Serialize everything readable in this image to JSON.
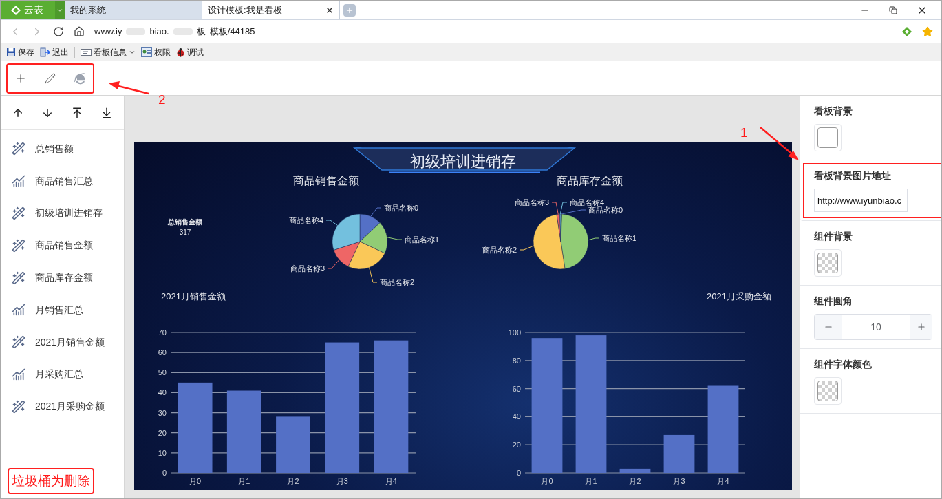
{
  "browser_tabs": [
    {
      "label": "云表",
      "kind": "app",
      "selected": false
    },
    {
      "label": "我的系统",
      "kind": "page",
      "selected": false
    },
    {
      "label": "设计模板:我是看板",
      "kind": "page",
      "selected": true
    }
  ],
  "address": {
    "parts": [
      "www.iy",
      "biao.",
      "板",
      "模板/44185"
    ]
  },
  "toolbar": [
    {
      "label": "保存",
      "kind": "save"
    },
    {
      "label": "退出",
      "kind": "exit"
    },
    {
      "label": "看板信息",
      "kind": "info"
    },
    {
      "label": "权限",
      "kind": "permission"
    },
    {
      "label": "调试",
      "kind": "debug"
    }
  ],
  "sidebar": {
    "items": [
      {
        "label": "总销售额",
        "kind": "metric"
      },
      {
        "label": "商品销售汇总",
        "kind": "chart"
      },
      {
        "label": "初级培训进销存",
        "kind": "metric"
      },
      {
        "label": "商品销售金额",
        "kind": "metric"
      },
      {
        "label": "商品库存金额",
        "kind": "metric"
      },
      {
        "label": "月销售汇总",
        "kind": "chart"
      },
      {
        "label": "2021月销售金额",
        "kind": "metric"
      },
      {
        "label": "月采购汇总",
        "kind": "chart"
      },
      {
        "label": "2021月采购金额",
        "kind": "metric"
      }
    ]
  },
  "dashboard": {
    "title": "初级培训进销存",
    "kpi": {
      "label": "总销售金额",
      "value": "317"
    },
    "pies": [
      {
        "title": "商品销售金额",
        "labels": [
          "商品名称0",
          "商品名称1",
          "商品名称2",
          "商品名称3",
          "商品名称4"
        ]
      },
      {
        "title": "商品库存金额",
        "labels": [
          "商品名称0",
          "商品名称1",
          "商品名称2",
          "商品名称3",
          "商品名称4"
        ]
      }
    ],
    "bar_charts": [
      {
        "chart_data": {
          "type": "bar",
          "title": "2021月销售金额",
          "categories": [
            "月0",
            "月1",
            "月2",
            "月3",
            "月4"
          ],
          "series": [
            {
              "color": "#5470c6",
              "values": [
                45,
                41,
                28,
                65,
                66
              ]
            }
          ],
          "grid": true,
          "ylim": [
            0,
            70
          ],
          "yticks": [
            0,
            10,
            20,
            30,
            40,
            50,
            60,
            70
          ]
        }
      },
      {
        "chart_data": {
          "type": "bar",
          "title": "2021月采购金额",
          "categories": [
            "月0",
            "月1",
            "月2",
            "月3",
            "月4"
          ],
          "series": [
            {
              "color": "#5470c6",
              "values": [
                96,
                98,
                3,
                27,
                62
              ]
            }
          ],
          "grid": true,
          "ylim": [
            0,
            100
          ],
          "yticks": [
            0,
            20,
            40,
            60,
            80,
            100
          ]
        }
      }
    ]
  },
  "properties": [
    {
      "label": "看板背景",
      "kind": "swatch",
      "transparent": false
    },
    {
      "label": "看板背景图片地址",
      "kind": "text",
      "value": "http://www.iyunbiao.c"
    },
    {
      "label": "组件背景",
      "kind": "swatch",
      "transparent": true
    },
    {
      "label": "组件圆角",
      "kind": "stepper",
      "value": "10"
    },
    {
      "label": "组件字体颜色",
      "kind": "swatch",
      "transparent": true
    }
  ],
  "annotations": {
    "callout_1": "1",
    "callout_2": "2",
    "note": "垃圾桶为删除"
  }
}
